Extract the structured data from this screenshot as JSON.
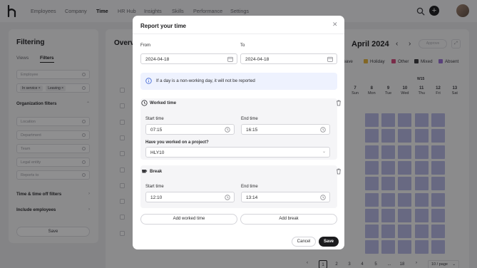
{
  "nav": {
    "items": [
      "Employees",
      "Company",
      "Time",
      "HR Hub",
      "Insights",
      "Skills",
      "Performance",
      "Settings"
    ],
    "active": "Time"
  },
  "filter_panel": {
    "title": "Filtering",
    "tabs": [
      "Views",
      "Filters"
    ],
    "active_tab": "Filters",
    "employee_placeholder": "Employee",
    "status_chips": [
      "In service",
      "Leaving"
    ],
    "org_section": "Organization filters",
    "org_fields": [
      "Location",
      "Department",
      "Team",
      "Legal entity",
      "Reports to"
    ],
    "time_section": "Time & time off filters",
    "include_section": "Include employees",
    "save_label": "Save"
  },
  "main": {
    "title": "Overview",
    "month": "April 2024",
    "approve_label": "Approve",
    "legend": [
      {
        "label": "Leave",
        "color": "#8fa0e8"
      },
      {
        "label": "Holiday",
        "color": "#e8b63a"
      },
      {
        "label": "Other",
        "color": "#d9487d"
      },
      {
        "label": "Mixed",
        "color": "#3a3a3e"
      },
      {
        "label": "Absent",
        "color": "#9b6fd9"
      }
    ],
    "week_label": "W15",
    "days": [
      {
        "num": "7",
        "name": "Sun"
      },
      {
        "num": "8",
        "name": "Mon"
      },
      {
        "num": "9",
        "name": "Tue"
      },
      {
        "num": "10",
        "name": "Wed"
      },
      {
        "num": "11",
        "name": "Thu"
      },
      {
        "num": "12",
        "name": "Fri"
      },
      {
        "num": "13",
        "name": "Sat"
      }
    ],
    "pagination": {
      "pages": [
        "1",
        "2",
        "3",
        "4",
        "5",
        "...",
        "18"
      ],
      "active_page": "1",
      "per_page": "10 / page"
    }
  },
  "modal": {
    "title": "Report your time",
    "from_label": "From",
    "to_label": "To",
    "from_value": "2024-04-18",
    "to_value": "2024-04-18",
    "info_text": "If a day is a non-working day, it will not be reported",
    "worked": {
      "title": "Worked time",
      "start_label": "Start time",
      "end_label": "End time",
      "start_value": "07:15",
      "end_value": "16:15",
      "project_label": "Have you worked on a project?",
      "project_value": "HLY10"
    },
    "break": {
      "title": "Break",
      "start_label": "Start time",
      "end_label": "End time",
      "start_value": "12:10",
      "end_value": "13:14"
    },
    "add_worked_label": "Add worked time",
    "add_break_label": "Add break",
    "cancel_label": "Cancel",
    "save_label": "Save"
  }
}
